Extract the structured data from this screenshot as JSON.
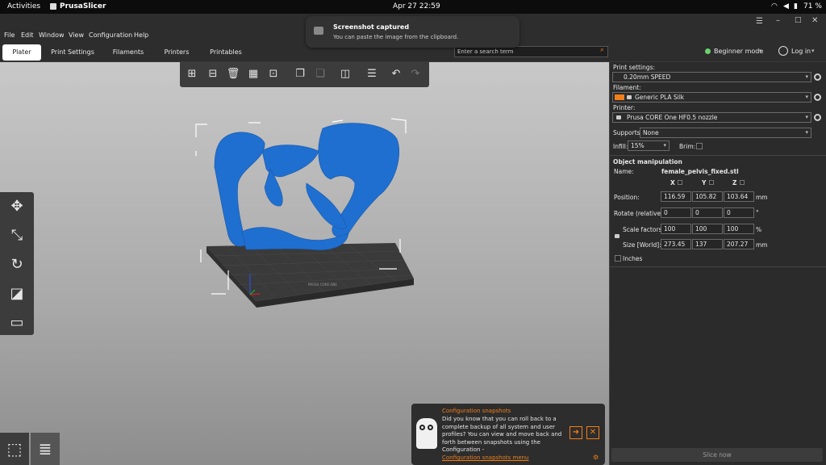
{
  "topbar": {
    "activities": "Activities",
    "app_name": "PrusaSlicer",
    "clock": "Apr 27  22:59",
    "battery": "71 %"
  },
  "notification": {
    "title": "Screenshot captured",
    "body": "You can paste the image from the clipboard."
  },
  "menu": [
    "File",
    "Edit",
    "Window",
    "View",
    "Configuration",
    "Help"
  ],
  "tabs": [
    "Plater",
    "Print Settings",
    "Filaments",
    "Printers",
    "Printables"
  ],
  "active_tab": "Plater",
  "search": {
    "placeholder": "Enter a search term"
  },
  "mode": {
    "label": "Beginner mode",
    "color": "#6bd16b"
  },
  "login": "Log in",
  "settings": {
    "print_label": "Print settings:",
    "print_value": "0.20mm SPEED",
    "filament_label": "Filament:",
    "filament_value": "Generic PLA Silk",
    "filament_color": "#f07f1a",
    "printer_label": "Printer:",
    "printer_value": "Prusa CORE One HF0.5 nozzle",
    "supports_label": "Supports:",
    "supports_value": "None",
    "infill_label": "Infill:",
    "infill_value": "15%",
    "brim_label": "Brim:"
  },
  "object_manipulation": {
    "header": "Object manipulation",
    "name_label": "Name:",
    "name_value": "female_pelvis_fixed.stl",
    "axes": [
      "X",
      "Y",
      "Z"
    ],
    "position_label": "Position:",
    "position": [
      "116.59",
      "105.82",
      "103.64"
    ],
    "position_unit": "mm",
    "rotate_label": "Rotate (relative):",
    "rotate": [
      "0",
      "0",
      "0"
    ],
    "rotate_unit": "°",
    "scale_label": "Scale factors:",
    "scale": [
      "100",
      "100",
      "100"
    ],
    "scale_unit": "%",
    "size_label": "Size [World]:",
    "size": [
      "273.45",
      "137",
      "207.27"
    ],
    "size_unit": "mm",
    "inches_label": "Inches"
  },
  "hint": {
    "title": "Configuration snapshots",
    "body": "Did you know that you can roll back to a complete backup of all system and user profiles? You can view and move back and forth between snapshots using the Configuration -",
    "link": "Configuration snapshots menu"
  },
  "slice_button": "Slice now",
  "brand_colors": {
    "accent": "#f07f1a",
    "model": "#1f6fd1"
  }
}
